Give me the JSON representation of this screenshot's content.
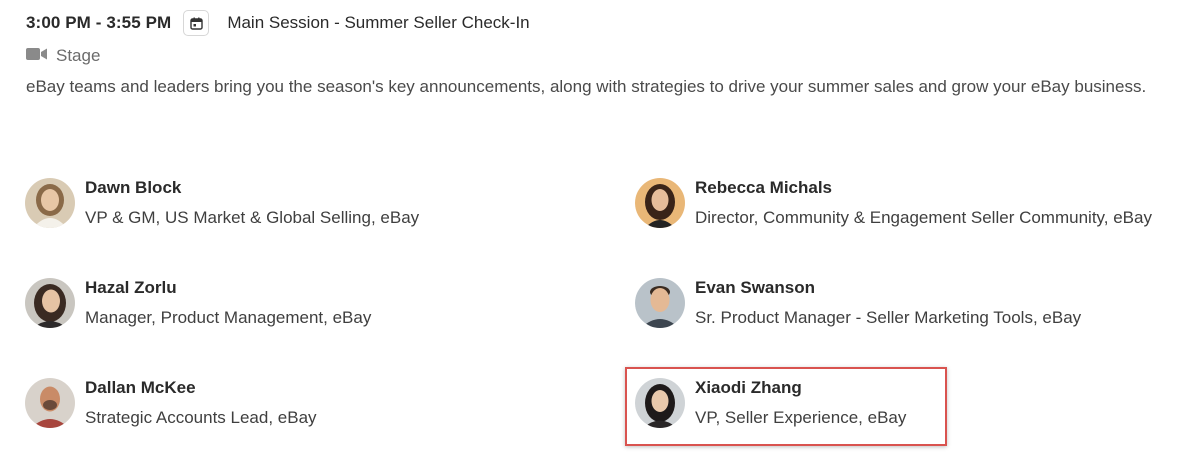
{
  "session": {
    "time": "3:00 PM - 3:55 PM",
    "calendar_icon": "calendar-icon",
    "title": "Main Session - Summer Seller Check-In",
    "location_icon": "video-camera-icon",
    "location": "Stage",
    "description": "eBay teams and leaders bring you the season's key announcements, along with strategies to drive your summer sales and grow your eBay business."
  },
  "speakers": [
    {
      "name": "Dawn Block",
      "role": "VP & GM, US Market & Global Selling, eBay"
    },
    {
      "name": "Rebecca Michals",
      "role": "Director, Community & Engagement Seller Community, eBay"
    },
    {
      "name": "Hazal Zorlu",
      "role": "Manager, Product Management, eBay"
    },
    {
      "name": "Evan Swanson",
      "role": "Sr. Product Manager - Seller Marketing Tools, eBay"
    },
    {
      "name": "Dallan McKee",
      "role": "Strategic Accounts Lead, eBay"
    },
    {
      "name": "Xiaodi Zhang",
      "role": "VP, Seller Experience, eBay"
    }
  ],
  "colors": {
    "highlight_border": "#d9534f",
    "text_primary": "#2a2a2a",
    "text_secondary": "#6b6b6b"
  }
}
